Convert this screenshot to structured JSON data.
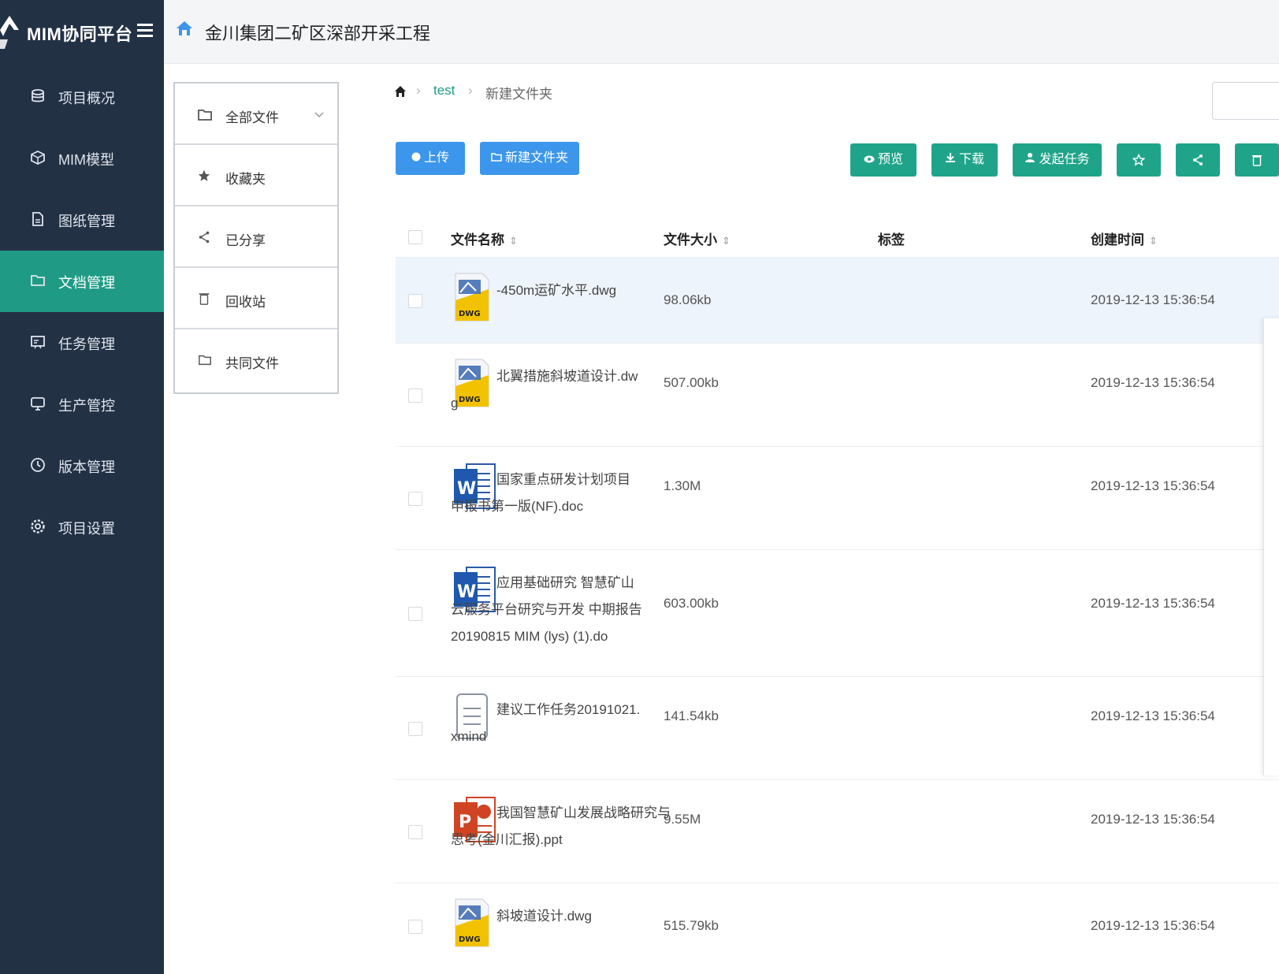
{
  "sidebar": {
    "logo_text": "MIM协同平台",
    "items": [
      {
        "label": "项目概况",
        "icon": "database-icon"
      },
      {
        "label": "MIM模型",
        "icon": "cube-icon"
      },
      {
        "label": "图纸管理",
        "icon": "drawing-file-icon"
      },
      {
        "label": "文档管理",
        "icon": "folder-icon",
        "active": true
      },
      {
        "label": "任务管理",
        "icon": "task-board-icon"
      },
      {
        "label": "生产管控",
        "icon": "monitor-icon"
      },
      {
        "label": "版本管理",
        "icon": "clock-icon"
      },
      {
        "label": "项目设置",
        "icon": "settings-icon"
      }
    ]
  },
  "header": {
    "project_title": "金川集团二矿区深部开采工程"
  },
  "folders": {
    "items": [
      {
        "label": "全部文件",
        "icon": "folder-icon"
      },
      {
        "label": "收藏夹",
        "icon": "star-icon"
      },
      {
        "label": "已分享",
        "icon": "share-icon"
      },
      {
        "label": "回收站",
        "icon": "trash-icon"
      },
      {
        "label": "共同文件",
        "icon": "shared-folder-icon"
      }
    ]
  },
  "breadcrumb": {
    "link": "test",
    "current": "新建文件夹"
  },
  "toolbar": {
    "upload": "上传",
    "new_folder": "新建文件夹",
    "preview": "预览",
    "download": "下载",
    "assign_task": "发起任务"
  },
  "table": {
    "headers": {
      "name": "文件名称",
      "size": "文件大小",
      "tag": "标签",
      "created": "创建时间"
    },
    "rows": [
      {
        "type": "dwg",
        "name_lines": [
          "-450m运矿水平.dwg"
        ],
        "size": "98.06kb",
        "created": "2019-12-13 15:36:54"
      },
      {
        "type": "dwg",
        "name_lines": [
          "北翼措施斜坡道设计.dw",
          "g"
        ],
        "size": "507.00kb",
        "created": "2019-12-13 15:36:54"
      },
      {
        "type": "doc",
        "name_lines": [
          "国家重点研发计划项目",
          "申报书第一版(NF).doc"
        ],
        "size": "1.30M",
        "created": "2019-12-13 15:36:54"
      },
      {
        "type": "doc",
        "name_lines": [
          "应用基础研究 智慧矿山",
          "云服务平台研究与开发 中期报告",
          "20190815 MIM (lys) (1).do"
        ],
        "size": "603.00kb",
        "created": "2019-12-13 15:36:54"
      },
      {
        "type": "xmind",
        "name_lines": [
          "建议工作任务20191021.",
          "xmind"
        ],
        "size": "141.54kb",
        "created": "2019-12-13 15:36:54"
      },
      {
        "type": "ppt",
        "name_lines": [
          "我国智慧矿山发展战略研究与",
          "思考(金川汇报).ppt"
        ],
        "size": "9.55M",
        "created": "2019-12-13 15:36:54"
      },
      {
        "type": "dwg",
        "name_lines": [
          "斜坡道设计.dwg"
        ],
        "size": "515.79kb",
        "created": "2019-12-13 15:36:54"
      }
    ]
  },
  "colors": {
    "sidebar_bg": "#233145",
    "accent_green": "#1fa48a",
    "accent_blue": "#3b96ec"
  }
}
